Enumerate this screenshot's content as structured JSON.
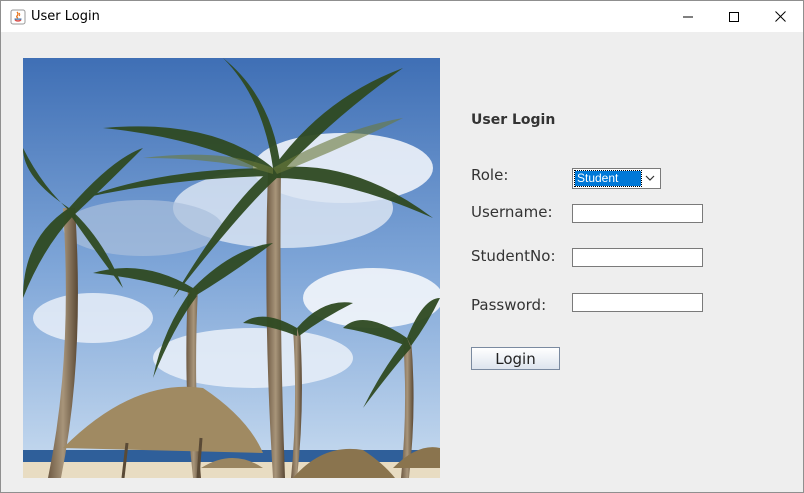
{
  "window": {
    "title": "User Login",
    "controls": [
      "minimize-icon",
      "maximize-icon",
      "close-icon"
    ]
  },
  "form": {
    "heading": "User Login",
    "role_label": "Role:",
    "role_selected": "Student",
    "username_label": "Username:",
    "username_value": "",
    "studentno_label": "StudentNo:",
    "studentno_value": "",
    "password_label": "Password:",
    "password_value": "",
    "login_label": "Login"
  },
  "image": {
    "subject": "beach-palm-trees-photo"
  },
  "colors": {
    "selection": "#0078d7",
    "background": "#eeeeee"
  }
}
